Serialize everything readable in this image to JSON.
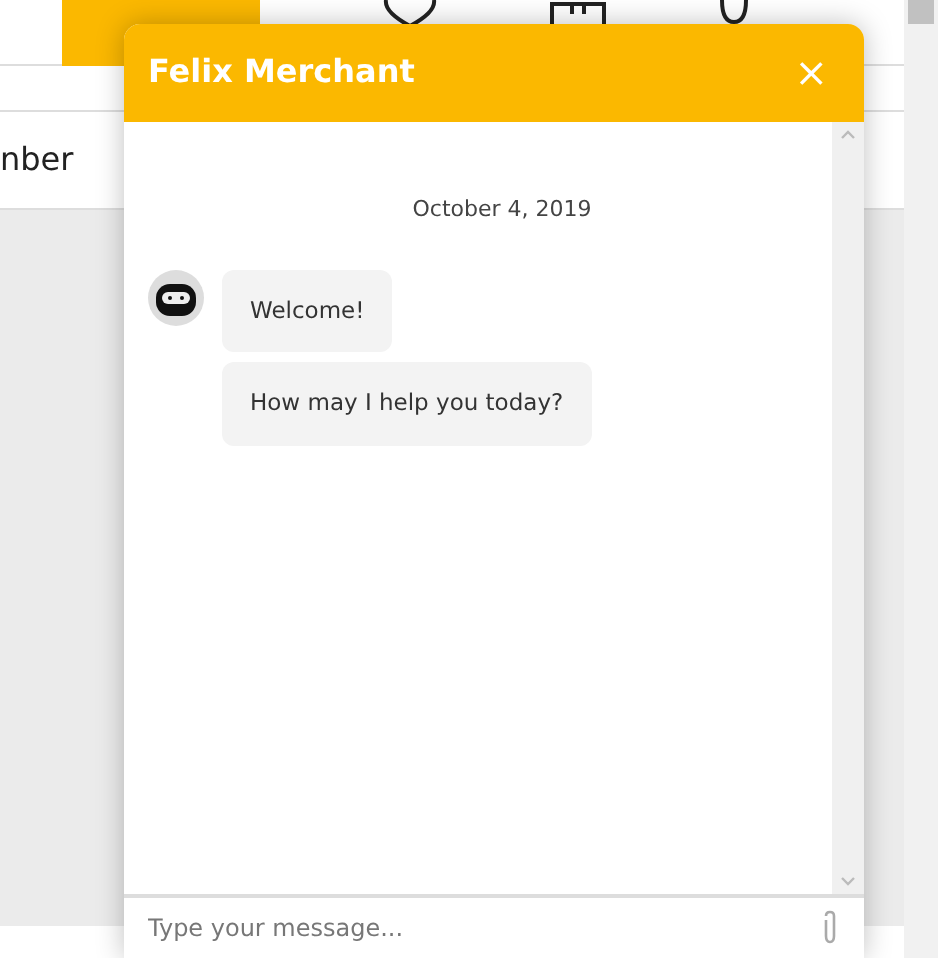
{
  "page": {
    "field_text": "nber"
  },
  "chat": {
    "title": "Felix Merchant",
    "close": "×",
    "date": "October 4, 2019",
    "messages": [
      {
        "text": "Welcome!"
      },
      {
        "text": "How may I help you today?"
      }
    ],
    "input": {
      "placeholder": "Type your message..."
    }
  }
}
